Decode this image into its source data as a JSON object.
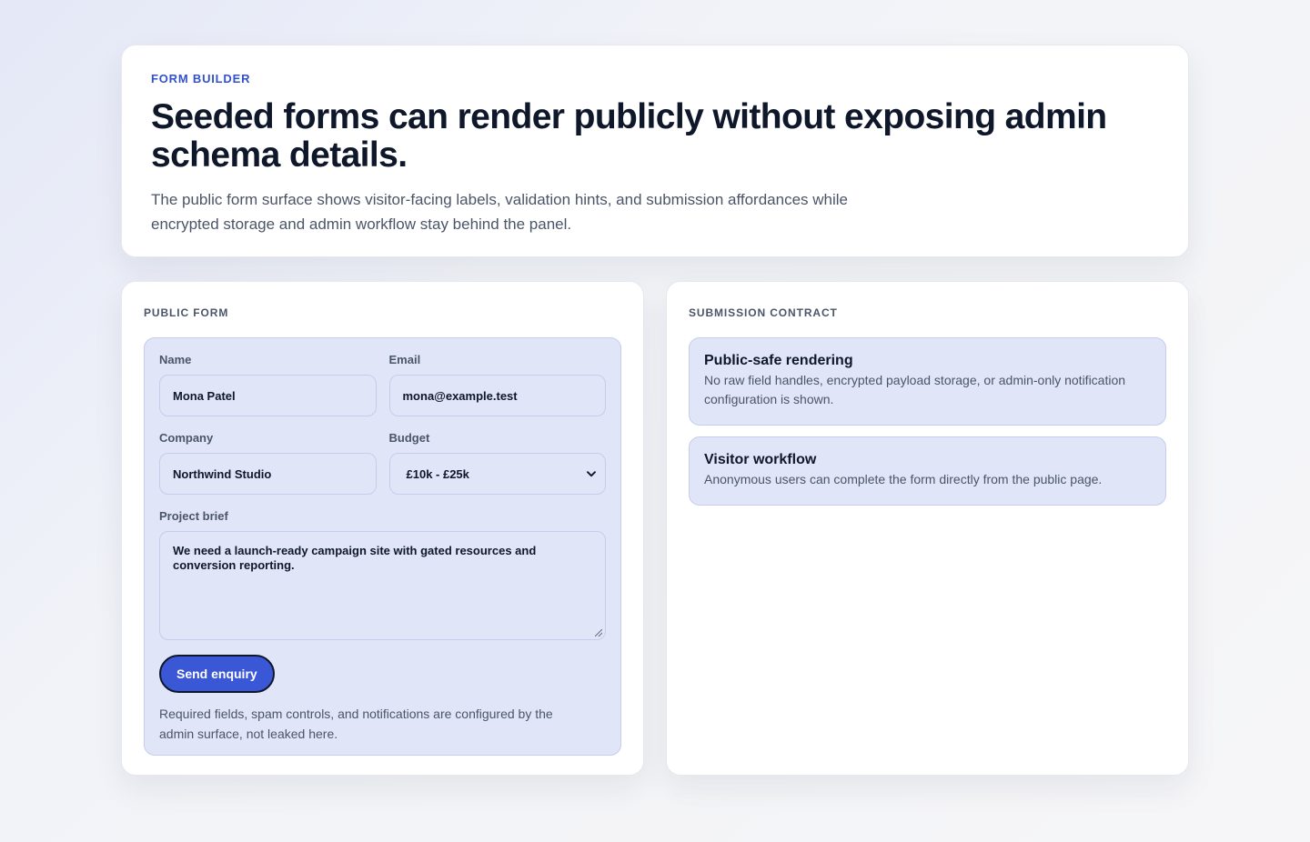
{
  "hero": {
    "eyebrow": "FORM BUILDER",
    "title": "Seeded forms can render publicly without exposing admin schema details.",
    "description": "The public form surface shows visitor-facing labels, validation hints, and submission affordances while encrypted storage and admin workflow stay behind the panel."
  },
  "public_form": {
    "heading": "PUBLIC FORM",
    "fields": {
      "name": {
        "label": "Name",
        "value": "Mona Patel"
      },
      "email": {
        "label": "Email",
        "value": "mona@example.test"
      },
      "company": {
        "label": "Company",
        "value": "Northwind Studio"
      },
      "budget": {
        "label": "Budget",
        "value": "£10k - £25k"
      },
      "brief": {
        "label": "Project brief",
        "value": "We need a launch-ready campaign site with gated resources and conversion reporting."
      }
    },
    "submit_label": "Send enquiry",
    "note": "Required fields, spam controls, and notifications are configured by the admin surface, not leaked here."
  },
  "submission_contract": {
    "heading": "SUBMISSION CONTRACT",
    "cards": [
      {
        "title": "Public-safe rendering",
        "body": "No raw field handles, encrypted payload storage, or admin-only notification configuration is shown."
      },
      {
        "title": "Visitor workflow",
        "body": "Anonymous users can complete the form directly from the public page."
      }
    ]
  },
  "colors": {
    "accent": "#3a57d6",
    "eyebrow": "#3351cc",
    "form_fill": "#e0e5f8",
    "heading_text": "#0f172a",
    "muted_text": "#4b5568"
  },
  "icons": {
    "select_chevron": "chevron-down-icon"
  }
}
